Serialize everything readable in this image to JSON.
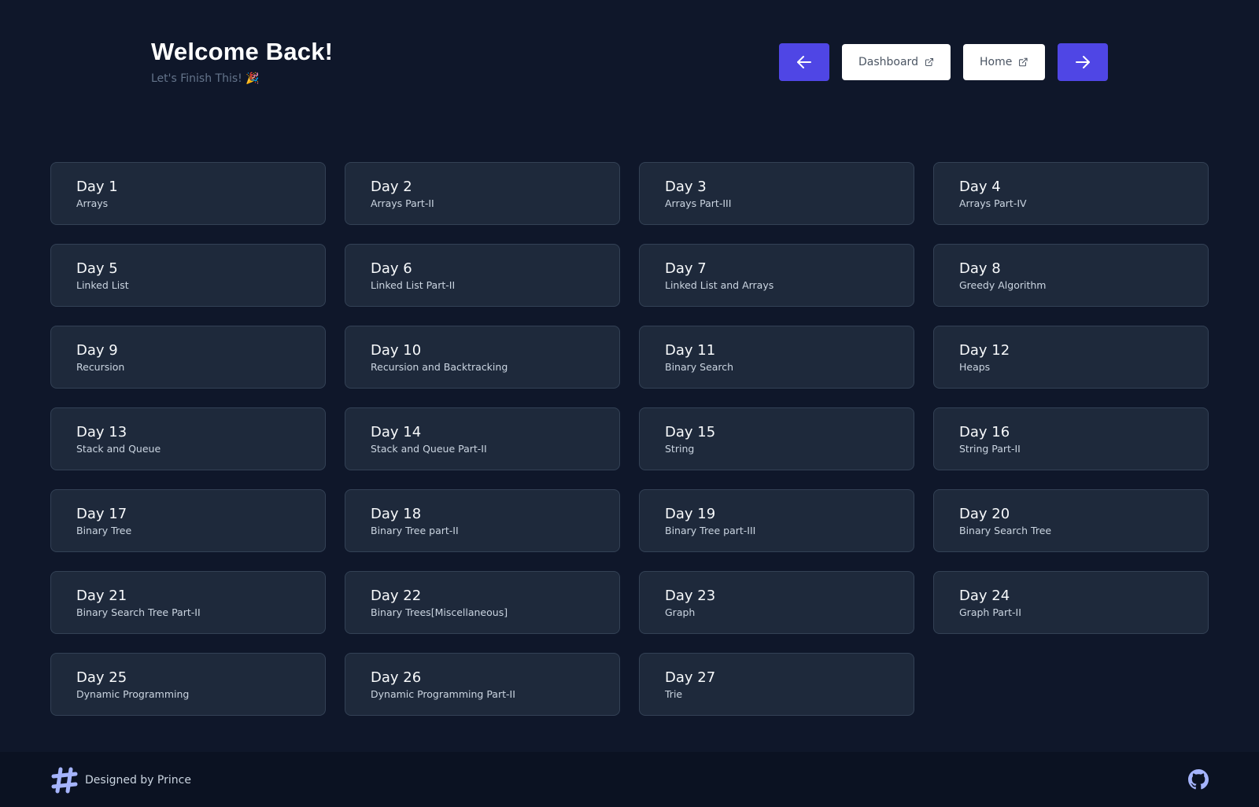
{
  "header": {
    "title": "Welcome Back!",
    "subtitle": "Let's Finish This! 🎉"
  },
  "nav": {
    "prev_icon": "arrow-left-icon",
    "dashboard_label": "Dashboard",
    "home_label": "Home",
    "next_icon": "arrow-right-icon",
    "external_icon": "external-link-icon"
  },
  "days": [
    {
      "day": "Day 1",
      "topic": "Arrays"
    },
    {
      "day": "Day 2",
      "topic": "Arrays Part-II"
    },
    {
      "day": "Day 3",
      "topic": "Arrays Part-III"
    },
    {
      "day": "Day 4",
      "topic": "Arrays Part-IV"
    },
    {
      "day": "Day 5",
      "topic": "Linked List"
    },
    {
      "day": "Day 6",
      "topic": "Linked List Part-II"
    },
    {
      "day": "Day 7",
      "topic": "Linked List and Arrays"
    },
    {
      "day": "Day 8",
      "topic": "Greedy Algorithm"
    },
    {
      "day": "Day 9",
      "topic": "Recursion"
    },
    {
      "day": "Day 10",
      "topic": "Recursion and Backtracking"
    },
    {
      "day": "Day 11",
      "topic": "Binary Search"
    },
    {
      "day": "Day 12",
      "topic": "Heaps"
    },
    {
      "day": "Day 13",
      "topic": "Stack and Queue"
    },
    {
      "day": "Day 14",
      "topic": "Stack and Queue Part-II"
    },
    {
      "day": "Day 15",
      "topic": "String"
    },
    {
      "day": "Day 16",
      "topic": "String Part-II"
    },
    {
      "day": "Day 17",
      "topic": "Binary Tree"
    },
    {
      "day": "Day 18",
      "topic": "Binary Tree part-II"
    },
    {
      "day": "Day 19",
      "topic": "Binary Tree part-III"
    },
    {
      "day": "Day 20",
      "topic": "Binary Search Tree"
    },
    {
      "day": "Day 21",
      "topic": "Binary Search Tree Part-II"
    },
    {
      "day": "Day 22",
      "topic": "Binary Trees[Miscellaneous]"
    },
    {
      "day": "Day 23",
      "topic": "Graph"
    },
    {
      "day": "Day 24",
      "topic": "Graph Part-II"
    },
    {
      "day": "Day 25",
      "topic": "Dynamic Programming"
    },
    {
      "day": "Day 26",
      "topic": "Dynamic Programming Part-II"
    },
    {
      "day": "Day 27",
      "topic": "Trie"
    }
  ],
  "footer": {
    "credit": "Designed by Prince",
    "logo_icon": "hashtag-icon",
    "github_icon": "github-icon"
  },
  "colors": {
    "background": "#0f172a",
    "card": "#1e293b",
    "accent": "#4f46e5"
  }
}
